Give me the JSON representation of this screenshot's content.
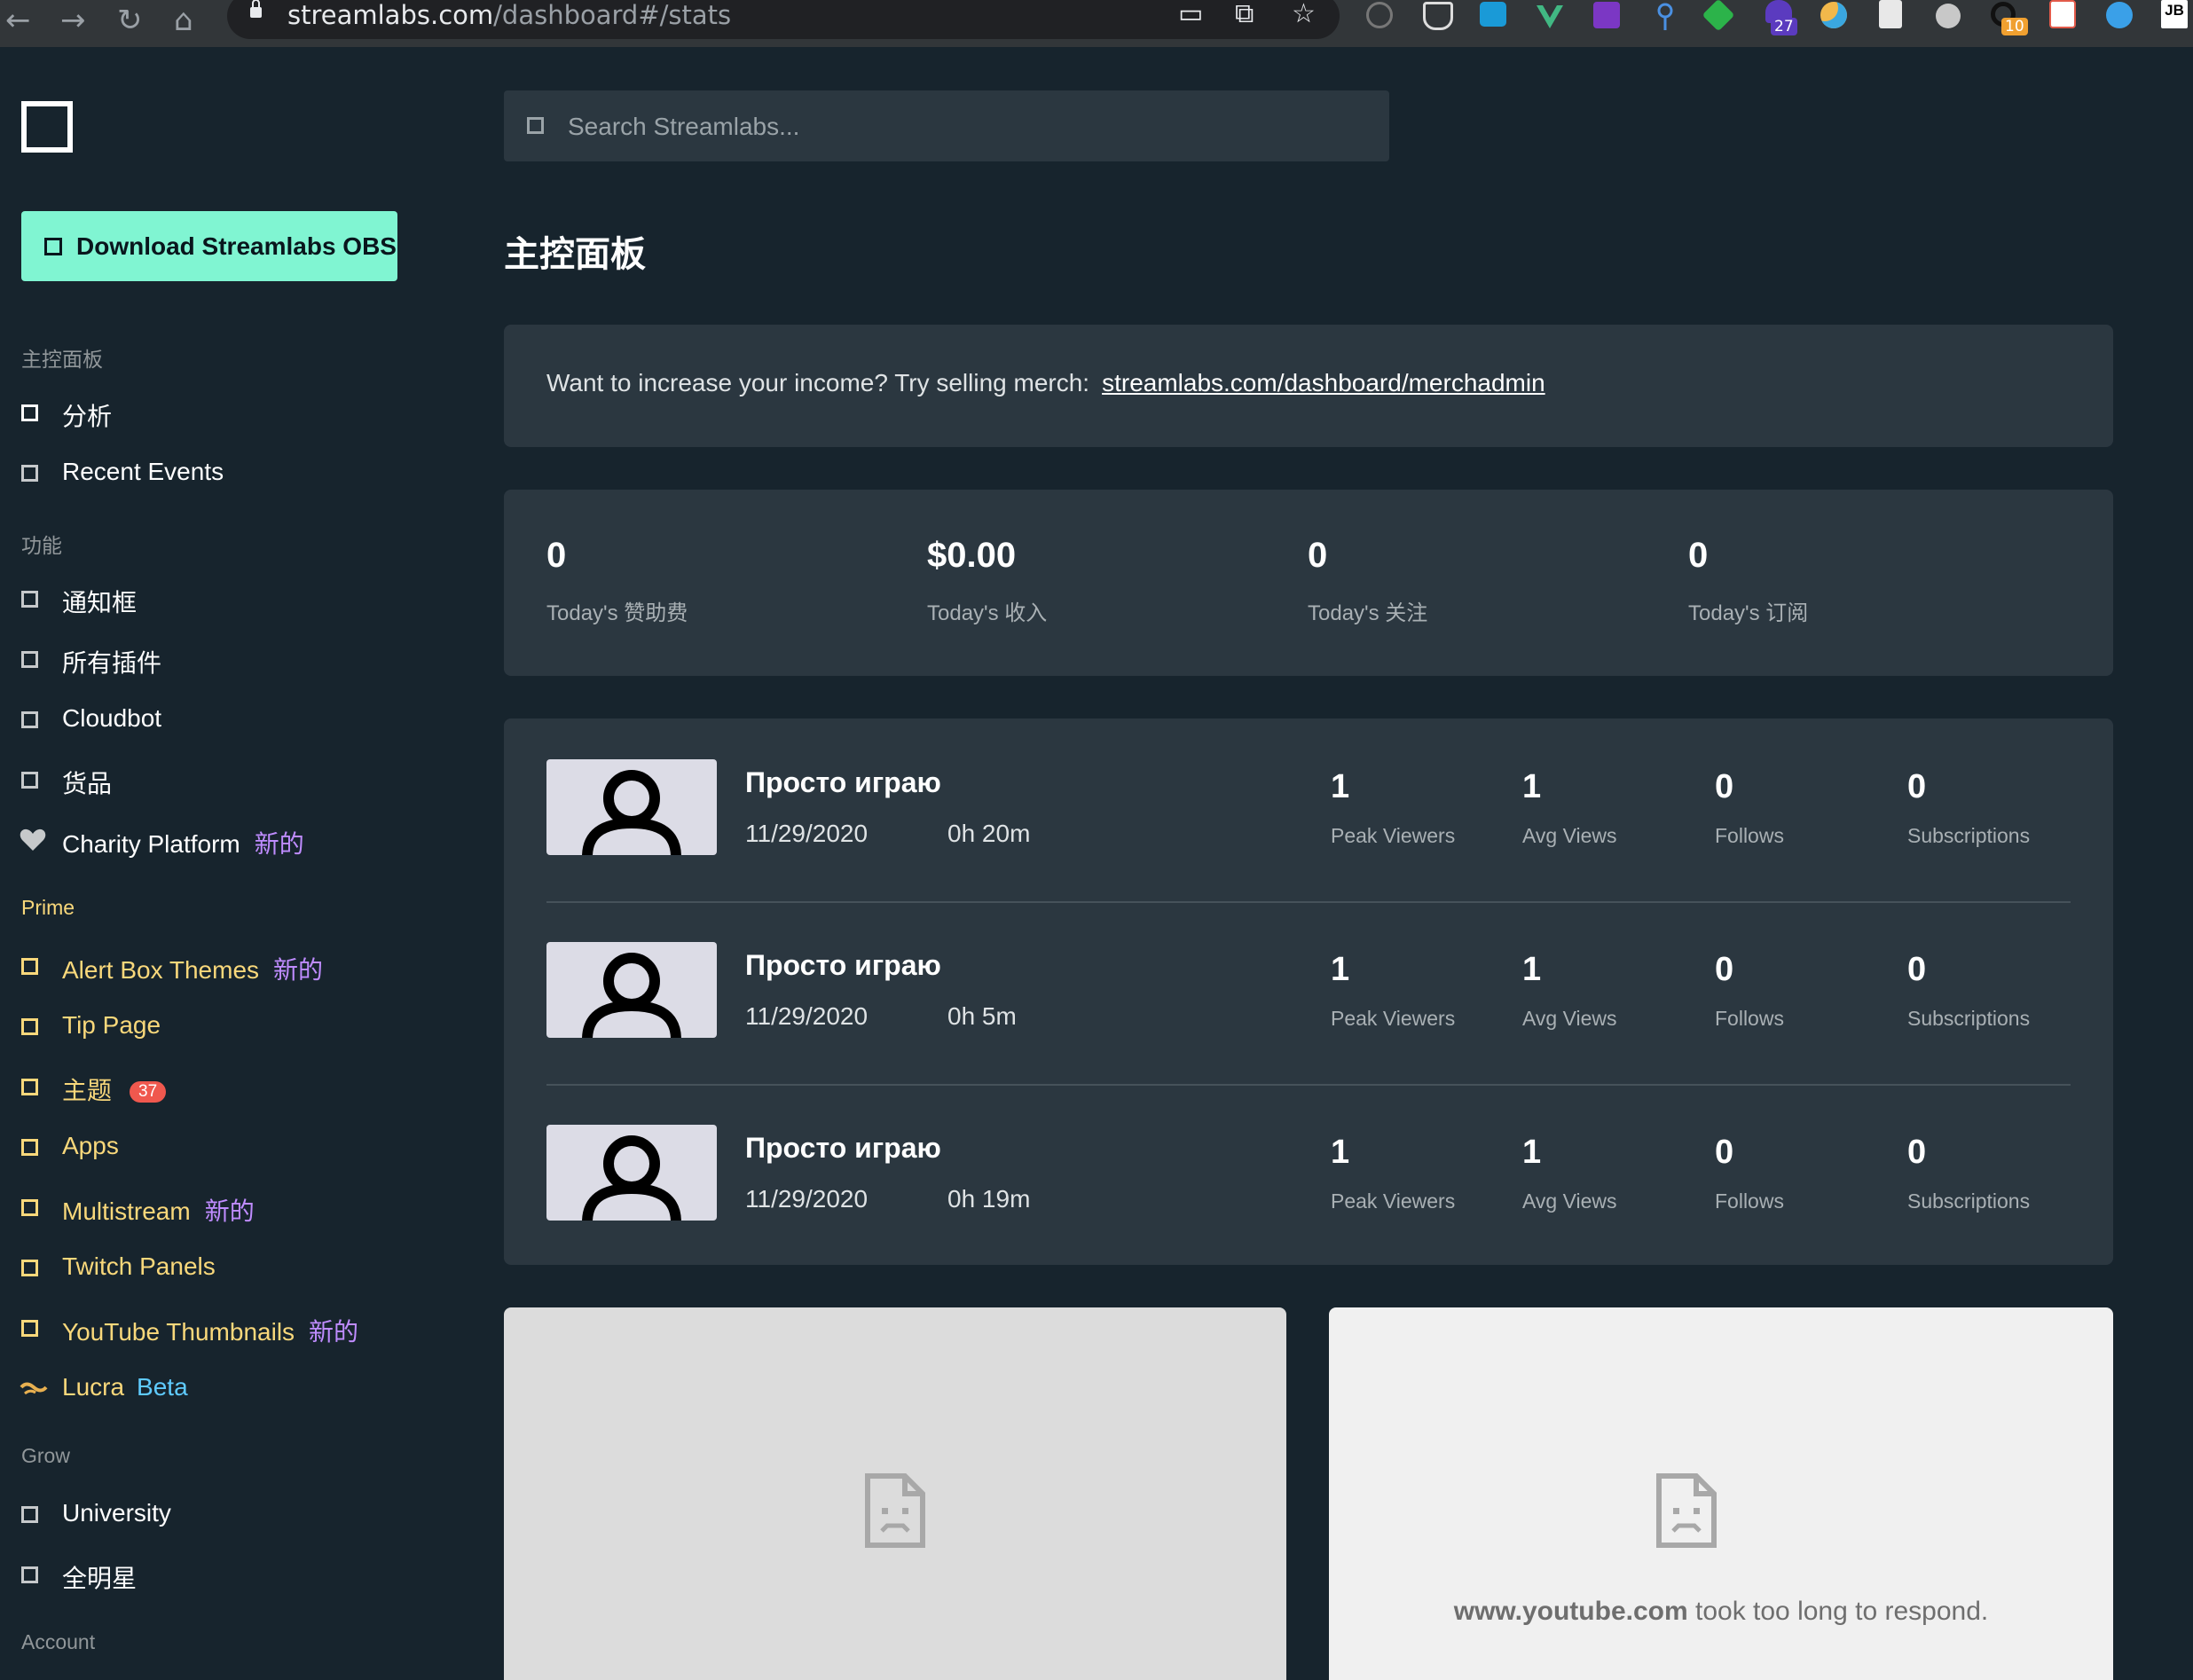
{
  "browser": {
    "url_host": "streamlabs.com",
    "url_path": "/dashboard#/stats",
    "extension_badges": [
      "27",
      "10"
    ],
    "extension_corner_label": "JB"
  },
  "sidebar": {
    "download_button": "Download Streamlabs OBS",
    "sections": {
      "dashboard": {
        "title": "主控面板",
        "items": [
          {
            "label": "分析"
          },
          {
            "label": "Recent Events"
          }
        ]
      },
      "features": {
        "title": "功能",
        "items": [
          {
            "label": "通知框"
          },
          {
            "label": "所有插件"
          },
          {
            "label": "Cloudbot"
          },
          {
            "label": "货品"
          },
          {
            "label": "Charity Platform",
            "tag": "新的",
            "icon": "heart-icon"
          }
        ]
      },
      "prime": {
        "title": "Prime",
        "items": [
          {
            "label": "Alert Box Themes",
            "tag": "新的"
          },
          {
            "label": "Tip Page"
          },
          {
            "label": "主题",
            "badge": "37"
          },
          {
            "label": "Apps"
          },
          {
            "label": "Multistream",
            "tag": "新的"
          },
          {
            "label": "Twitch Panels"
          },
          {
            "label": "YouTube Thumbnails",
            "tag": "新的"
          },
          {
            "label": "Lucra",
            "tag": "Beta",
            "icon": "lucra-icon"
          }
        ]
      },
      "grow": {
        "title": "Grow",
        "items": [
          {
            "label": "University"
          },
          {
            "label": "全明星"
          }
        ]
      },
      "account": {
        "title": "Account"
      }
    }
  },
  "main": {
    "search_placeholder": "Search Streamlabs...",
    "page_title": "主控面板",
    "merch_banner": {
      "text": "Want to increase your income? Try selling merch:",
      "link": "streamlabs.com/dashboard/merchadmin"
    },
    "today_stats": [
      {
        "value": "0",
        "label": "Today's 赞助费"
      },
      {
        "value": "$0.00",
        "label": "Today's 收入"
      },
      {
        "value": "0",
        "label": "Today's 关注"
      },
      {
        "value": "0",
        "label": "Today's 订阅"
      }
    ],
    "streams": [
      {
        "title": "Просто играю",
        "date": "11/29/2020",
        "duration": "0h 20m",
        "stats": [
          {
            "v": "1",
            "l": "Peak Viewers"
          },
          {
            "v": "1",
            "l": "Avg Views"
          },
          {
            "v": "0",
            "l": "Follows"
          },
          {
            "v": "0",
            "l": "Subscriptions"
          }
        ]
      },
      {
        "title": "Просто играю",
        "date": "11/29/2020",
        "duration": "0h 5m",
        "stats": [
          {
            "v": "1",
            "l": "Peak Viewers"
          },
          {
            "v": "1",
            "l": "Avg Views"
          },
          {
            "v": "0",
            "l": "Follows"
          },
          {
            "v": "0",
            "l": "Subscriptions"
          }
        ]
      },
      {
        "title": "Просто играю",
        "date": "11/29/2020",
        "duration": "0h 19m",
        "stats": [
          {
            "v": "1",
            "l": "Peak Viewers"
          },
          {
            "v": "1",
            "l": "Avg Views"
          },
          {
            "v": "0",
            "l": "Follows"
          },
          {
            "v": "0",
            "l": "Subscriptions"
          }
        ]
      }
    ],
    "embeds": [
      {
        "error_host": "",
        "error_message": ""
      },
      {
        "error_host": "www.youtube.com",
        "error_message": " took too long to respond."
      }
    ]
  },
  "colors": {
    "background": "#17242d",
    "card": "#2b3740",
    "accent_green": "#80f5d2",
    "prime_gold": "#f9d87b",
    "new_tag_purple": "#bf8cff",
    "beta_blue": "#5fcbff",
    "badge_red": "#f0584e"
  }
}
